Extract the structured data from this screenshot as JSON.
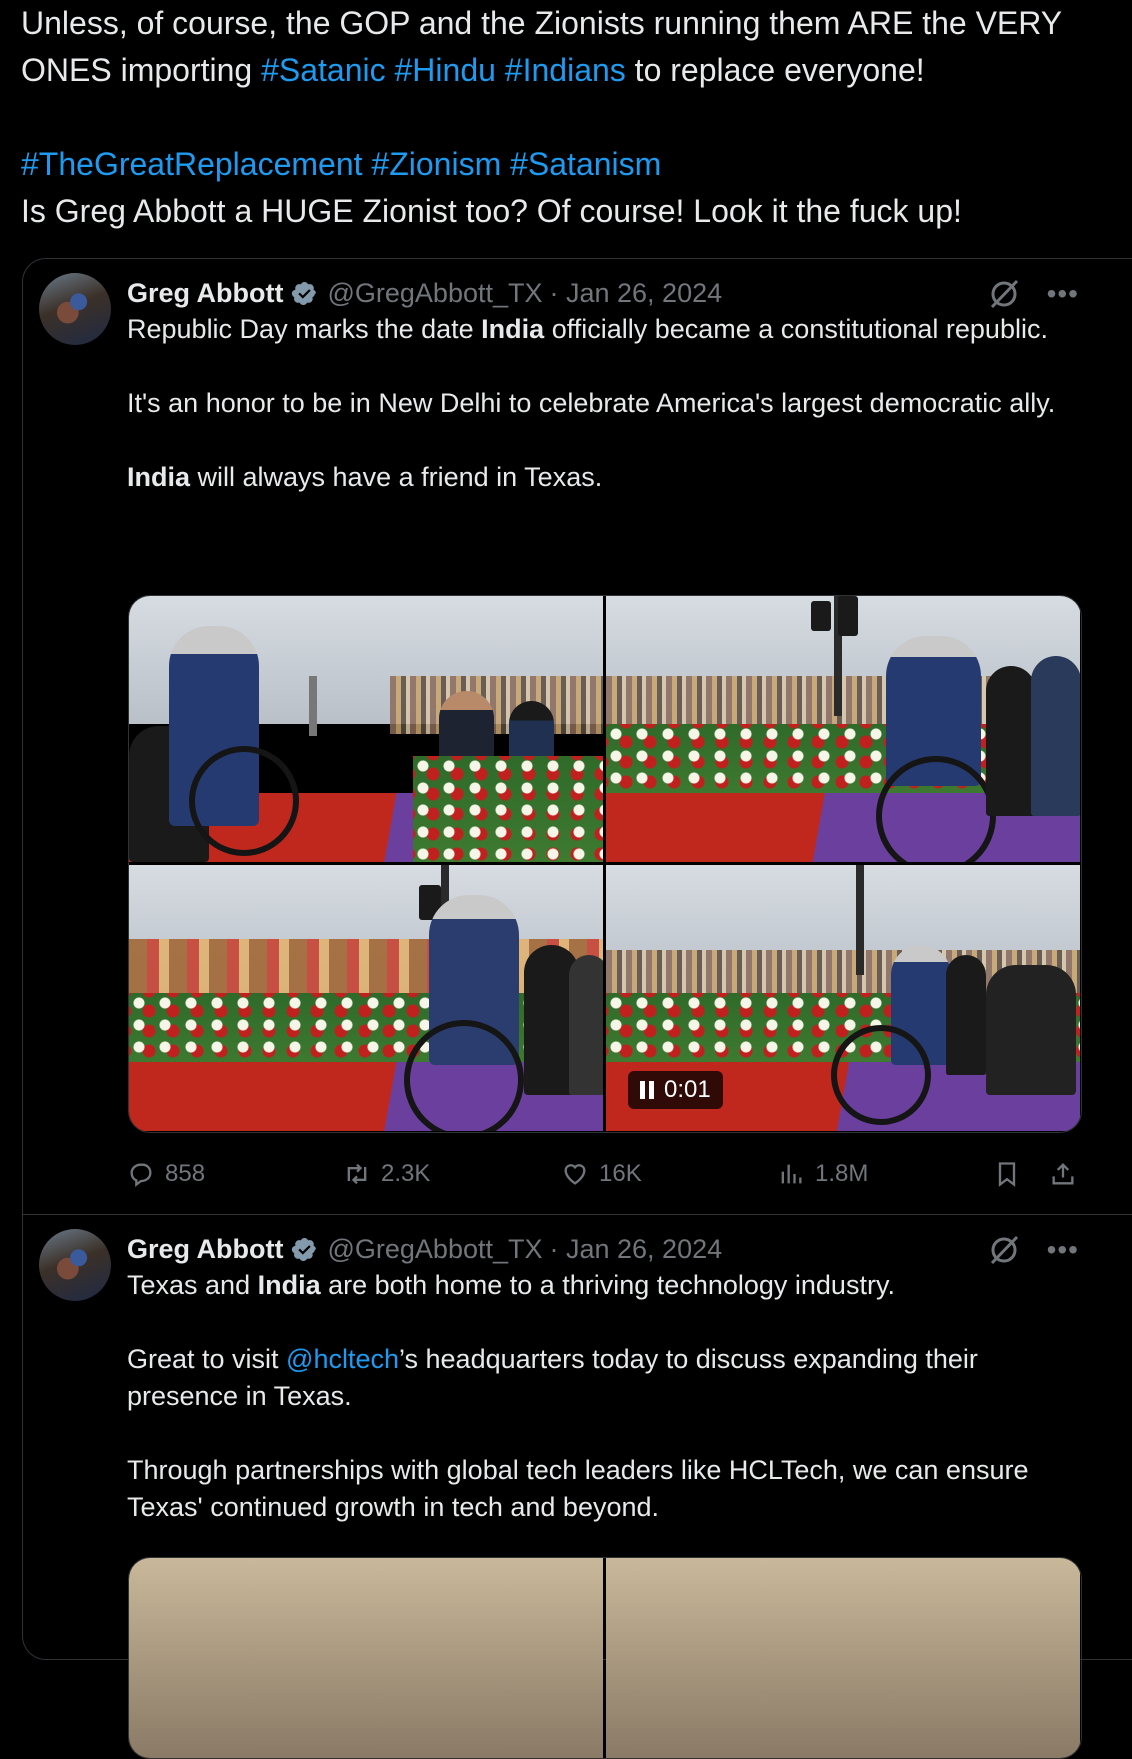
{
  "post": {
    "line1": "Unless, of course, the GOP and the Zionists running them ARE the VERY",
    "line2_prefix": "ONES importing ",
    "line2_tags": [
      "#Satanic",
      "#Hindu",
      "#Indians"
    ],
    "line2_suffix": " to replace everyone!",
    "tags_line": [
      "#TheGreatReplacement",
      "#Zionism",
      "#Satanism"
    ],
    "line4": "Is Greg Abbott a HUGE Zionist too? Of course! Look it the fuck up!"
  },
  "quote": {
    "tweets": [
      {
        "name": "Greg Abbott",
        "handle": "@GregAbbott_TX",
        "date": "· Jan 26, 2024",
        "para1_pre": "Republic Day marks the date ",
        "para1_bold": "India",
        "para1_post": " officially became a constitutional republic.",
        "para2": "It's an honor to be in New Delhi to celebrate America's largest democratic ally.",
        "para3_bold": "India",
        "para3_post": " will always have a friend in Texas.",
        "video_time": "0:01",
        "stats": {
          "replies": "858",
          "reposts": "2.3K",
          "likes": "16K",
          "views": "1.8M"
        }
      },
      {
        "name": "Greg Abbott",
        "handle": "@GregAbbott_TX",
        "date": "· Jan 26, 2024",
        "para1_pre": "Texas and ",
        "para1_bold": "India",
        "para1_post": " are both home to a thriving technology industry.",
        "para2_pre": "Great to visit ",
        "para2_mention": "@hcltech",
        "para2_post": "’s headquarters today to discuss expanding their presence in Texas.",
        "para3": "Through partnerships with global tech leaders like HCLTech, we can ensure Texas' continued growth in tech and beyond."
      }
    ]
  },
  "icons": {
    "verified": "verified-badge-icon",
    "grok": "grok-icon",
    "more": "more-icon",
    "reply": "reply-icon",
    "repost": "repost-icon",
    "like": "like-icon",
    "views": "views-icon",
    "bookmark": "bookmark-icon",
    "share": "share-icon"
  },
  "colors": {
    "background": "#000000",
    "text": "#e7e9ea",
    "link": "#1d9bf0",
    "muted": "#71767b",
    "border": "#2f3336"
  }
}
